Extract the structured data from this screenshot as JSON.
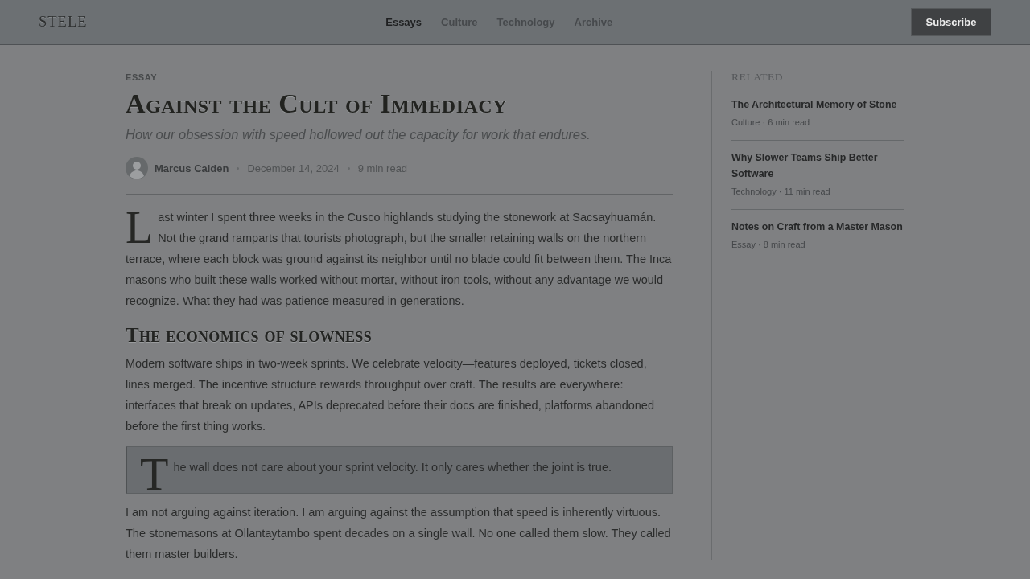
{
  "header": {
    "logo": "STELE",
    "nav": [
      {
        "label": "Essays",
        "selected": true
      },
      {
        "label": "Culture",
        "selected": false
      },
      {
        "label": "Technology",
        "selected": false
      },
      {
        "label": "Archive",
        "selected": false
      }
    ],
    "subscribe_button": "Subscribe"
  },
  "article": {
    "category": "ESSAY",
    "title": "Against the Cult of Immediacy",
    "subtitle": "How our obsession with speed hollowed out the capacity for work that endures.",
    "byline": {
      "author": "Marcus Calden",
      "date": "December 14, 2024",
      "read_time": "9 min read"
    },
    "body": [
      {
        "kind": "paragraph",
        "drop_cap": true,
        "text": "Last winter I spent three weeks in the Cusco highlands studying the stonework at Sacsayhuamán. Not the grand ramparts that tourists photograph, but the smaller retaining walls on the northern terrace, where each block was ground against its neighbor until no blade could fit between them. The Inca masons who built these walls worked without mortar, without iron tools, without any advantage we would recognize. What they had was patience measured in generations."
      },
      {
        "kind": "heading",
        "text": "The economics of slowness"
      },
      {
        "kind": "paragraph",
        "drop_cap": false,
        "text": "Modern software ships in two-week sprints. We celebrate velocity—features deployed, tickets closed, lines merged. The incentive structure rewards throughput over craft. The results are everywhere: interfaces that break on updates, APIs deprecated before their docs are finished, platforms abandoned before the first thing works."
      },
      {
        "kind": "quote",
        "text": "The wall does not care about your sprint velocity. It only cares whether the joint is true."
      },
      {
        "kind": "paragraph",
        "drop_cap": false,
        "text": "I am not arguing against iteration. I am arguing against the assumption that speed is inherently virtuous. The stonemasons at Ollantaytambo spent decades on a single wall. No one called them slow. They called them master builders."
      }
    ]
  },
  "sidebar": {
    "heading": "RELATED",
    "items": [
      {
        "title": "The Architectural Memory of Stone",
        "meta": "Culture · 6 min read"
      },
      {
        "title": "Why Slower Teams Ship Better Software",
        "meta": "Technology · 11 min read"
      },
      {
        "title": "Notes on Craft from a Master Mason",
        "meta": "Essay · 8 min read"
      }
    ]
  }
}
